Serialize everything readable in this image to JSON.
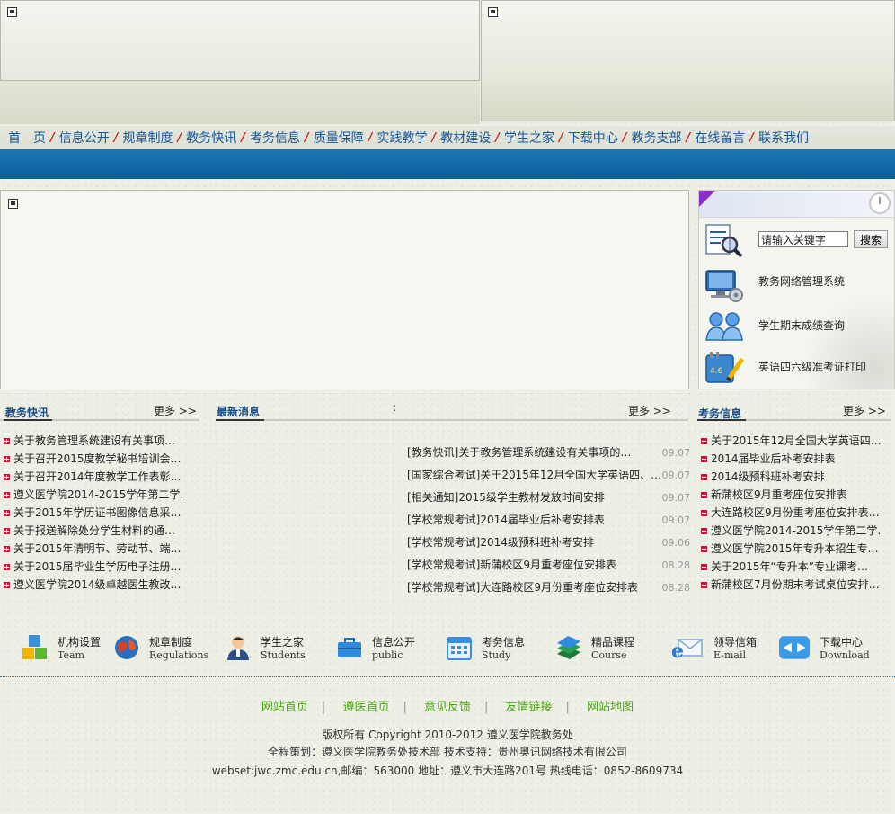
{
  "nav": [
    "首　页",
    "信息公开",
    "规章制度",
    "教务快讯",
    "考务信息",
    "质量保障",
    "实践教学",
    "教材建设",
    "学生之家",
    "下载中心",
    "教务支部",
    "在线留言",
    "联系我们"
  ],
  "quick": {
    "search_placeholder": "请输入关键字",
    "search_button": "搜索",
    "items": [
      "教务网络管理系统",
      "学生期末成绩查询",
      "英语四六级准考证打印"
    ]
  },
  "columns": {
    "left": {
      "title": "教务快讯",
      "more": "更多 >>",
      "items": [
        "关于教务管理系统建设有关事项…",
        "关于召开2015度教学秘书培训会…",
        "关于召开2014年度教学工作表彰…",
        "遵义医学院2014-2015学年第二学…",
        "关于2015年学历证书图像信息采…",
        "关于报送解除处分学生材料的通…",
        "关于2015年清明节、劳动节、端…",
        "关于2015届毕业生学历电子注册…",
        "遵义医学院2014级卓越医生教改…"
      ]
    },
    "center": {
      "title": "最新消息",
      "more": "更多 >>",
      "mark": ":",
      "items": [
        {
          "cat": "[教务快讯]",
          "title": "关于教务管理系统建设有关事项的…",
          "date": "09.07"
        },
        {
          "cat": "[国家综合考试]",
          "title": "关于2015年12月全国大学英语四、…",
          "date": "09.07"
        },
        {
          "cat": "[相关通知]",
          "title": "2015级学生教材发放时间安排",
          "date": "09.07"
        },
        {
          "cat": "[学校常规考试]",
          "title": "2014届毕业后补考安排表",
          "date": "09.07"
        },
        {
          "cat": "[学校常规考试]",
          "title": "2014级预科班补考安排",
          "date": "09.06"
        },
        {
          "cat": "[学校常规考试]",
          "title": "新蒲校区9月重考座位安排表",
          "date": "08.28"
        },
        {
          "cat": "[学校常规考试]",
          "title": "大连路校区9月份重考座位安排表",
          "date": "08.28"
        }
      ]
    },
    "right": {
      "title": "考务信息",
      "more": "更多 >>",
      "items": [
        "关于2015年12月全国大学英语四…",
        "2014届毕业后补考安排表",
        "2014级预科班补考安排",
        "新蒲校区9月重考座位安排表",
        "大连路校区9月份重考座位安排表…",
        "遵义医学院2014-2015学年第二学…",
        "遵义医学院2015年专升本招生专…",
        "关于2015年“专升本”专业课考…",
        "新蒲校区7月份期末考试桌位安排…"
      ]
    }
  },
  "icons": [
    {
      "cn": "机构设置",
      "en": "Team",
      "icon": "blocks-icon"
    },
    {
      "cn": "规章制度",
      "en": "Regulations",
      "icon": "globe-icon"
    },
    {
      "cn": "学生之家",
      "en": "Students",
      "icon": "student-icon"
    },
    {
      "cn": "信息公开",
      "en": "public",
      "icon": "briefcase-icon"
    },
    {
      "cn": "考务信息",
      "en": "Study",
      "icon": "calendar-icon"
    },
    {
      "cn": "精品课程",
      "en": "Course",
      "icon": "books-icon"
    },
    {
      "cn": "领导信箱",
      "en": "E-mail",
      "icon": "mail-icon"
    },
    {
      "cn": "下载中心",
      "en": "Download",
      "icon": "download-icon"
    }
  ],
  "footer": {
    "links": [
      "网站首页",
      "遵医首页",
      "意见反馈",
      "友情链接",
      "网站地图"
    ],
    "copyright": "版权所有  Copyright 2010-2012 遵义医学院教务处",
    "credits": "全程策划：遵义医学院教务处技术部  技术支持：贵州奥讯网络技术有限公司",
    "contact": "webset:jwc.zmc.edu.cn,邮编：563000 地址：遵义市大连路201号  热线电话：0852-8609734"
  },
  "colors": {
    "nav_text": "#17569a",
    "accent_blue": "#0c5f98",
    "bullet_red": "#c8183a",
    "link_green": "#4aa116"
  }
}
